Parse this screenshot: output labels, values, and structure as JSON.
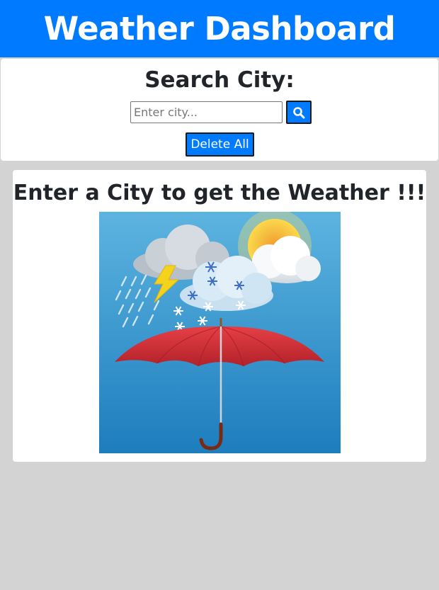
{
  "header": {
    "title": "Weather Dashboard"
  },
  "search": {
    "title": "Search City:",
    "placeholder": "Enter city...",
    "value": "",
    "button_icon": "search-icon",
    "delete_label": "Delete All"
  },
  "weather": {
    "prompt": "Enter a City to get the Weather !!!",
    "image_icon": "weather-illustration"
  },
  "colors": {
    "primary": "#007bff",
    "background": "#d3d3d3",
    "card": "#ffffff",
    "text": "#212529"
  }
}
